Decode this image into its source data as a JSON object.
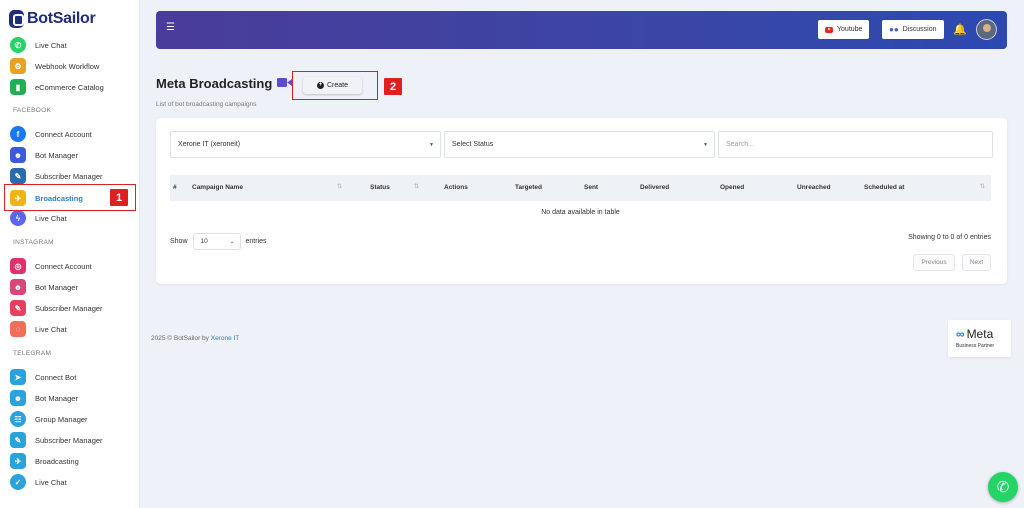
{
  "brand": {
    "name": "BotSailor"
  },
  "sidebar": {
    "top_items": [
      {
        "label": "Live Chat",
        "icon": "whatsapp-icon",
        "color": "#25d366"
      },
      {
        "label": "Webhook Workflow",
        "icon": "webhook-icon",
        "color": "#e5a320"
      },
      {
        "label": "eCommerce Catalog",
        "icon": "shopping-bag-icon",
        "color": "#20b054"
      }
    ],
    "sections": [
      {
        "title": "FACEBOOK",
        "items": [
          {
            "label": "Connect Account",
            "icon": "facebook-icon",
            "color": "#1877f2"
          },
          {
            "label": "Bot Manager",
            "icon": "robot-icon",
            "color": "#3b5bdb"
          },
          {
            "label": "Subscriber Manager",
            "icon": "subscriber-icon",
            "color": "#2b6cb0"
          },
          {
            "label": "Broadcasting",
            "icon": "broadcast-icon",
            "color": "#f0b419",
            "active": true
          },
          {
            "label": "Live Chat",
            "icon": "messenger-icon",
            "color": "#5a66f0"
          }
        ]
      },
      {
        "title": "INSTAGRAM",
        "items": [
          {
            "label": "Connect Account",
            "icon": "instagram-icon",
            "color": "#e1306c"
          },
          {
            "label": "Bot Manager",
            "icon": "robot-icon",
            "color": "#d9467a"
          },
          {
            "label": "Subscriber Manager",
            "icon": "subscriber-icon",
            "color": "#e8405c"
          },
          {
            "label": "Live Chat",
            "icon": "chat-icon",
            "color": "#f06e5a"
          }
        ]
      },
      {
        "title": "TELEGRAM",
        "items": [
          {
            "label": "Connect Bot",
            "icon": "telegram-icon",
            "color": "#2aa3dd"
          },
          {
            "label": "Bot Manager",
            "icon": "robot-icon",
            "color": "#2aa3dd"
          },
          {
            "label": "Group Manager",
            "icon": "group-icon",
            "color": "#2aa3dd"
          },
          {
            "label": "Subscriber Manager",
            "icon": "subscriber-icon",
            "color": "#2aa3dd"
          },
          {
            "label": "Broadcasting",
            "icon": "broadcast-icon",
            "color": "#2aa3dd"
          },
          {
            "label": "Live Chat",
            "icon": "chat-icon",
            "color": "#2aa3dd"
          }
        ]
      }
    ]
  },
  "header": {
    "youtube_label": "Youtube",
    "discussion_label": "Discussion"
  },
  "page": {
    "title": "Meta Broadcasting",
    "subtitle": "List of bot broadcasting campaigns",
    "create_label": "Create"
  },
  "markers": {
    "one": "1",
    "two": "2"
  },
  "filters": {
    "account": "Xerone IT (xeroneit)",
    "status": "Select Status",
    "search_placeholder": "Search..."
  },
  "table": {
    "columns": [
      "#",
      "Campaign Name",
      "Status",
      "Actions",
      "Targeted",
      "Sent",
      "Delivered",
      "Opened",
      "Unreached",
      "Scheduled at"
    ],
    "empty_text": "No data available in table",
    "show_label": "Show",
    "page_length": "10",
    "entries_label": "entries",
    "info": "Showing 0 to 0 of 0 entries",
    "previous_label": "Previous",
    "next_label": "Next"
  },
  "footer": {
    "copyright": "2025 © BotSailor by",
    "company": "Xerone IT"
  },
  "meta_badge": {
    "title": "Meta",
    "subtitle": "Business Partner"
  },
  "colors": {
    "accent": "#2b7bd8",
    "header_start": "#4a3c9a",
    "header_end": "#2c49b2",
    "marker_red": "#e02020"
  }
}
